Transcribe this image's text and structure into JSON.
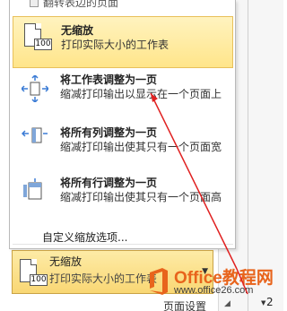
{
  "previous_item": {
    "label": "翻转表边的页面"
  },
  "menu": {
    "items": [
      {
        "title": "无缩放",
        "description": "打印实际大小的工作表",
        "icon": "page-100-icon",
        "selected": true
      },
      {
        "title": "将工作表调整为一页",
        "description": "缩减打印输出以显示在一个页面上",
        "icon": "fit-sheet-icon"
      },
      {
        "title": "将所有列调整为一页",
        "description": "缩减打印输出使其只有一个页面宽",
        "icon": "fit-columns-icon"
      },
      {
        "title": "将所有行调整为一页",
        "description": "缩减打印输出使其只有一个页面高",
        "icon": "fit-rows-icon"
      }
    ],
    "custom_label": "自定义缩放选项..."
  },
  "icon_label_100": "100",
  "combo": {
    "title": "无缩放",
    "description": "打印实际大小的工作表"
  },
  "ribbon": {
    "group_label": "页面设置",
    "page_number": "2"
  },
  "watermark": {
    "brand": "Office教程网",
    "url": "www.office26.com"
  },
  "colors": {
    "selected_bg": "#ffe58a",
    "arrow": "#e02020",
    "watermark_orange": "#e8641c"
  }
}
